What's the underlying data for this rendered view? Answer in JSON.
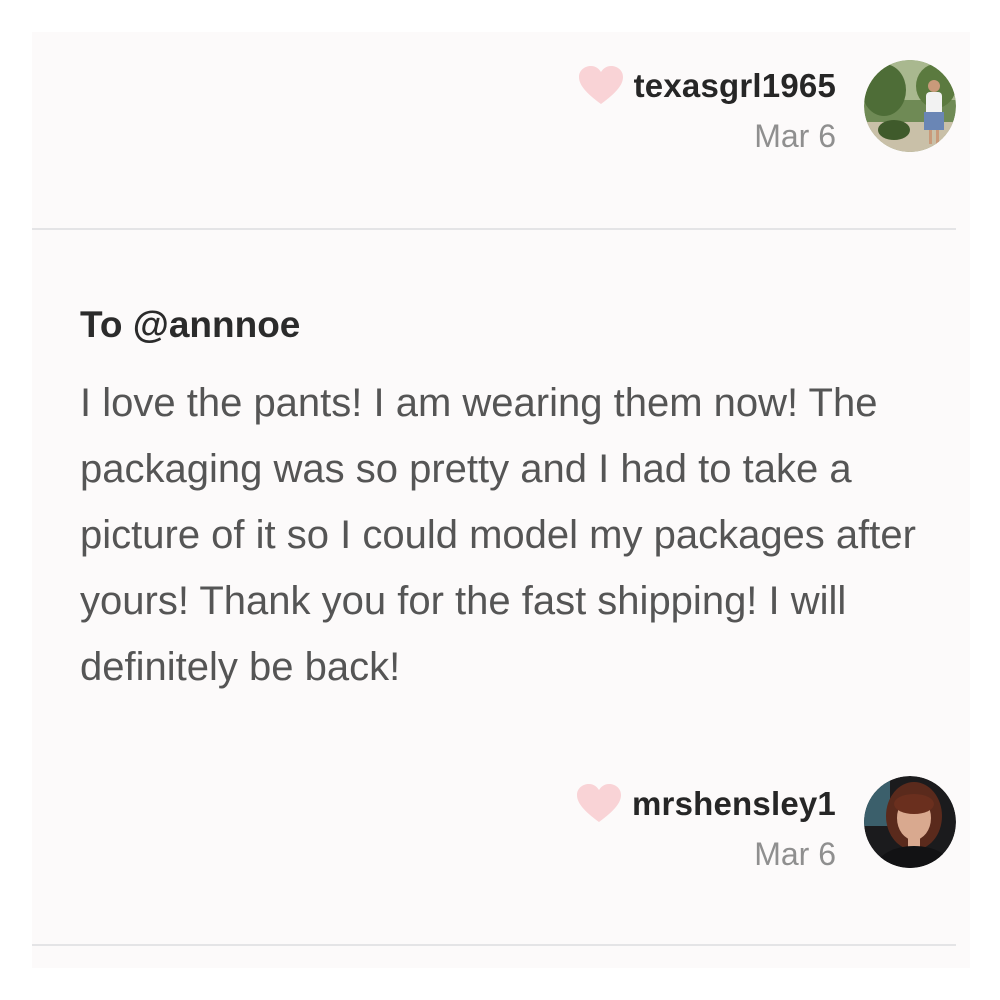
{
  "reviews": [
    {
      "username": "texasgrl1965",
      "date": "Mar 6",
      "heart_icon": "heart-icon",
      "avatar": "avatar-photo"
    },
    {
      "to": "To @annnoe",
      "body": "I love the pants! I am wearing them now! The packaging was so pretty and I had to take a picture of it so I could model my packages after yours! Thank you for the fast shipping! I will definitely be back!",
      "username": "mrshensley1",
      "date": "Mar 6",
      "heart_icon": "heart-icon",
      "avatar": "avatar-photo"
    }
  ],
  "colors": {
    "heart": "#f9d3d6",
    "username": "#262626",
    "date": "#8f8f8f",
    "body": "#555555",
    "divider": "#e4e4e6",
    "card_background": "#fcfafa"
  }
}
